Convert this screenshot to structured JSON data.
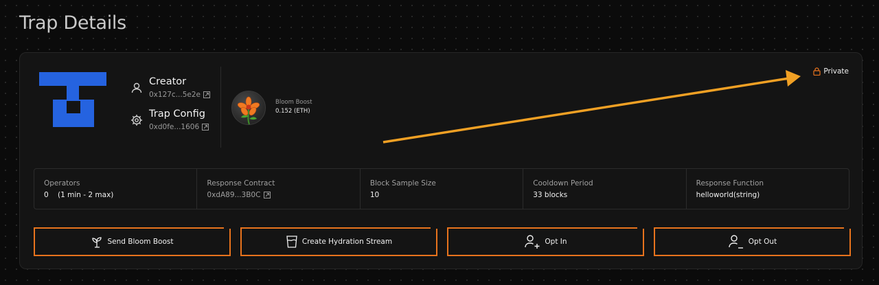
{
  "page": {
    "title": "Trap Details"
  },
  "creator": {
    "label": "Creator",
    "address": "0x127c...5e2e"
  },
  "trap_config": {
    "label": "Trap Config",
    "address": "0xd0fe...1606"
  },
  "bloom_boost": {
    "label": "Bloom Boost",
    "value": "0.152 (ETH)"
  },
  "visibility": {
    "label": "Private"
  },
  "stats": [
    {
      "label": "Operators",
      "value": "0    (1 min - 2 max)"
    },
    {
      "label": "Response Contract",
      "value": "0xdA89...3B0C"
    },
    {
      "label": "Block Sample Size",
      "value": "10"
    },
    {
      "label": "Cooldown Period",
      "value": "33 blocks"
    },
    {
      "label": "Response Function",
      "value": "helloworld(string)"
    }
  ],
  "actions": [
    {
      "label": "Send Bloom Boost",
      "icon": "sprout-icon"
    },
    {
      "label": "Create Hydration Stream",
      "icon": "water-glass-icon"
    },
    {
      "label": "Opt In",
      "icon": "user-plus-icon"
    },
    {
      "label": "Opt Out",
      "icon": "user-minus-icon"
    }
  ],
  "colors": {
    "accent": "#e8731d",
    "brand": "#2563e0",
    "annotation_arrow": "#f0a024",
    "background": "#0b0b0b",
    "card": "#141414"
  }
}
